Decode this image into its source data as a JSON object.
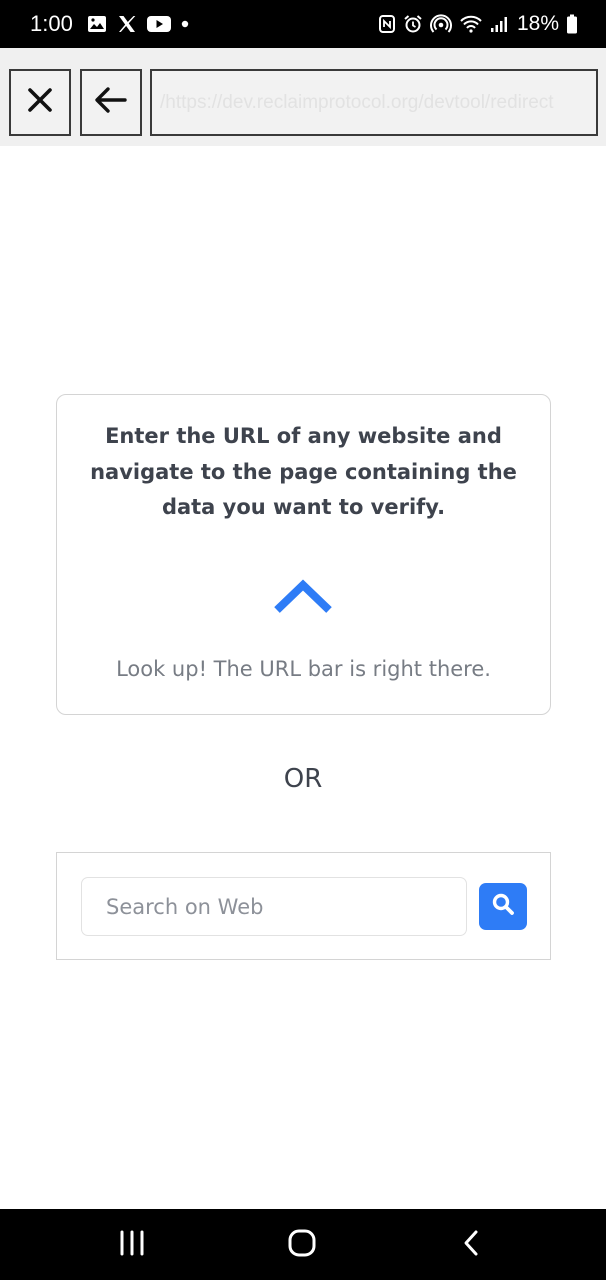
{
  "status_bar": {
    "time": "1:00",
    "battery_percent": "18%",
    "left_icons": [
      "gallery-icon",
      "x-logo-icon",
      "youtube-icon",
      "dot-icon"
    ],
    "right_icons": [
      "nfc-icon",
      "alarm-icon",
      "hotspot-icon",
      "wifi-icon",
      "signal-icon",
      "battery-icon"
    ]
  },
  "toolbar": {
    "close_icon": "close-icon",
    "back_icon": "arrow-left-icon",
    "url_value": "https://dev.reclaimprotocol.org/devtool/redirect/"
  },
  "info_card": {
    "message": "Enter the URL of any website and navigate to the page containing the data you want to verify.",
    "arrow_icon": "chevron-up-icon",
    "hint": "Look up! The URL bar is right there."
  },
  "divider_text": "OR",
  "search": {
    "placeholder": "Search on Web",
    "value": "",
    "button_icon": "search-icon"
  },
  "colors": {
    "accent": "#2e7cf6",
    "text_dark": "#3e434d",
    "text_muted": "#777c84"
  },
  "nav_bar": {
    "buttons": [
      "recents-icon",
      "home-icon",
      "back-icon"
    ]
  }
}
